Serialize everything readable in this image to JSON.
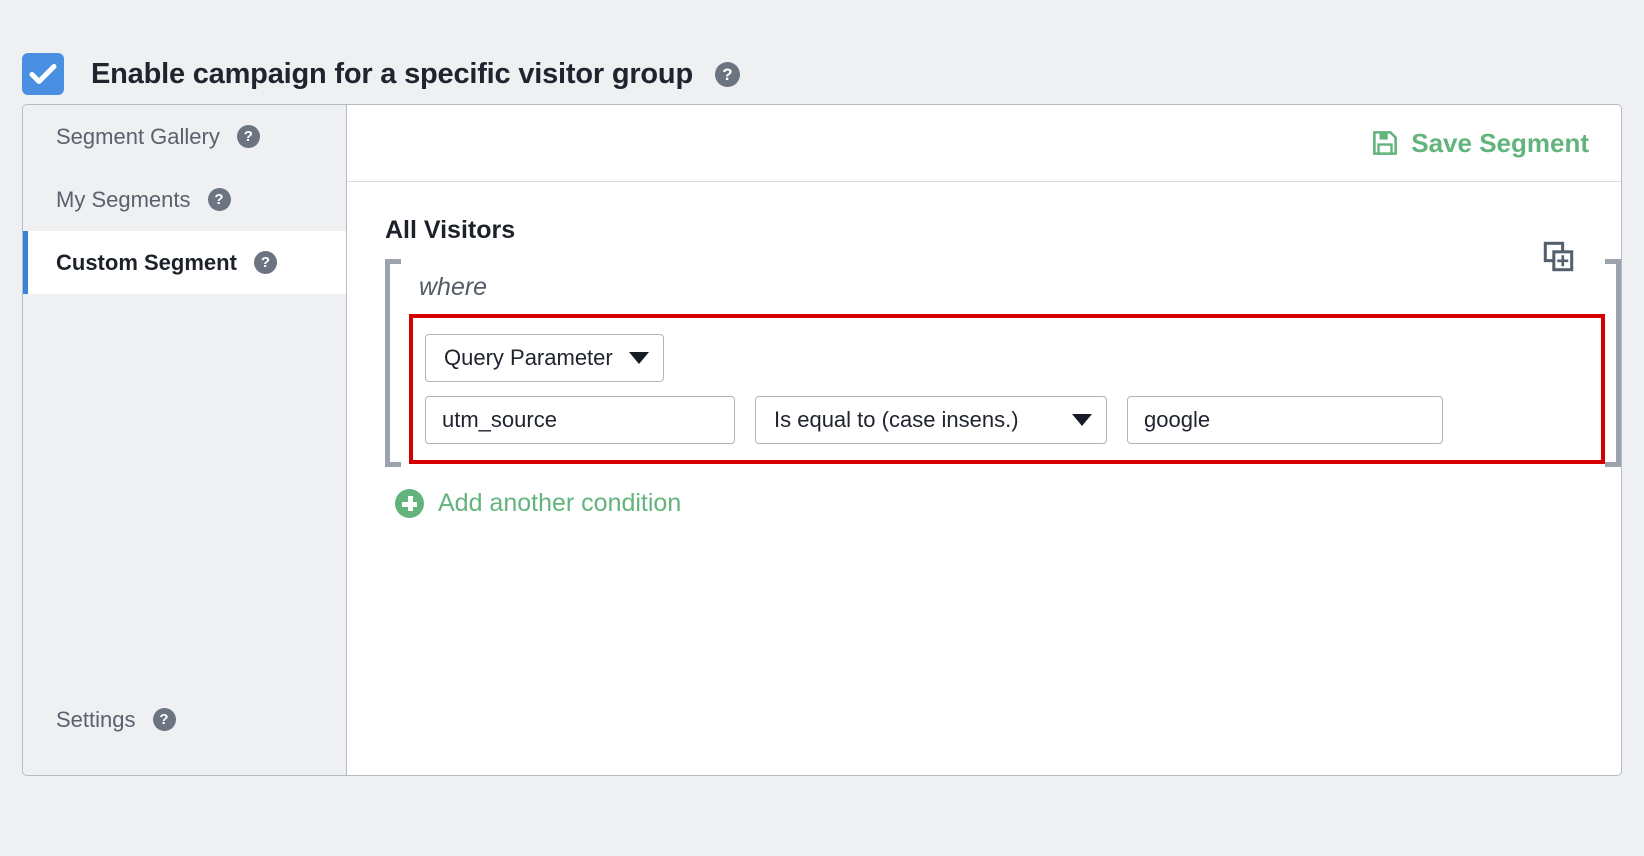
{
  "enable": {
    "label": "Enable campaign for a specific visitor group",
    "checked": true,
    "help": "?",
    "checkbox_color": "#4a90e2"
  },
  "sidebar": {
    "items": [
      {
        "label": "Segment Gallery",
        "help": "?",
        "active": false
      },
      {
        "label": "My Segments",
        "help": "?",
        "active": false
      },
      {
        "label": "Custom Segment",
        "help": "?",
        "active": true
      }
    ],
    "bottom": {
      "label": "Settings",
      "help": "?"
    },
    "active_accent": "#3a84d8"
  },
  "toolbar": {
    "save_label": "Save Segment",
    "save_icon": "floppy-disk-save-icon",
    "accent": "#63b47c"
  },
  "segment": {
    "title": "All Visitors",
    "where_label": "where",
    "duplicate_icon": "duplicate-add-icon",
    "highlight_color": "#d40000",
    "condition": {
      "attribute": "Query Parameter",
      "parameter_name": "utm_source",
      "operator": "Is equal to (case insens.)",
      "value": "google"
    },
    "add_condition_label": "Add another condition",
    "add_condition_icon": "plus-circle-icon"
  }
}
